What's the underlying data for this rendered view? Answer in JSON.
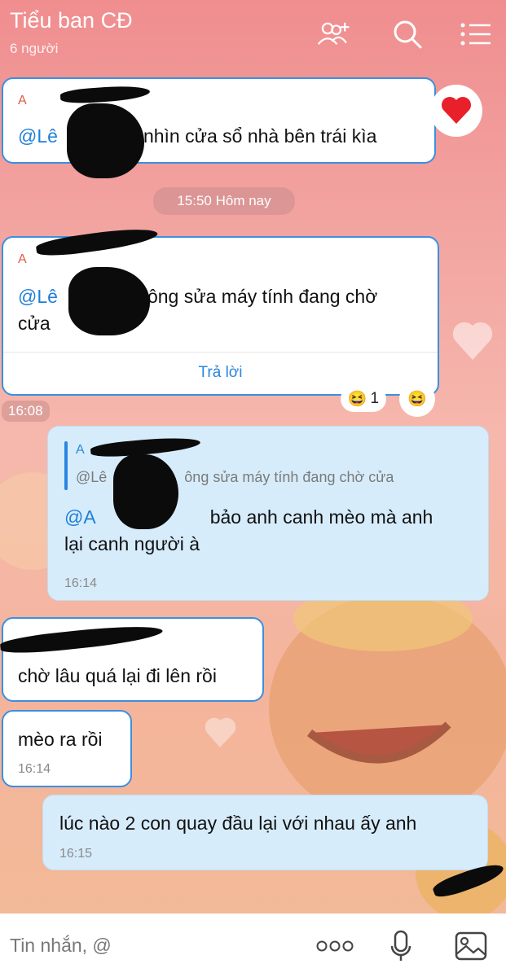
{
  "header": {
    "title": "Tiểu ban CĐ",
    "member_count": "6 người",
    "icons": [
      "add-member-icon",
      "search-icon",
      "menu-icon"
    ]
  },
  "messages": [
    {
      "id": "m1",
      "direction": "incoming",
      "quote_author": "A",
      "mention": "@Lê",
      "text": "nhìn cửa sổ nhà bên trái kìa",
      "reaction_icon": "heart"
    },
    {
      "id": "m2",
      "direction": "incoming",
      "quote_author": "A",
      "mention": "@Lê",
      "text_line1": "ông sửa máy tính đang chờ",
      "text_line2": "cửa",
      "reply_label": "Trả lời",
      "reaction_emoji": "😆",
      "reaction_count": "1",
      "time": "16:08"
    },
    {
      "id": "m3",
      "direction": "outgoing",
      "quote_author": "A",
      "quoted_mention": "@Lê",
      "quoted_text": "ông sửa máy tính đang chờ cửa",
      "mention": "@A",
      "text_line1": "bảo anh canh mèo mà anh",
      "text_line2": "lại canh người à",
      "time": "16:14"
    },
    {
      "id": "m4",
      "direction": "incoming",
      "text": "chờ lâu quá lại đi lên rồi"
    },
    {
      "id": "m5",
      "direction": "incoming",
      "text": "mèo ra rồi",
      "time": "16:14"
    },
    {
      "id": "m6",
      "direction": "outgoing",
      "text": "lúc nào 2 con quay đầu lại với nhau ấy anh",
      "time": "16:15"
    }
  ],
  "date_divider": "15:50 Hôm nay",
  "composer": {
    "placeholder": "Tin nhắn, @",
    "icons": [
      "more-icon",
      "microphone-icon",
      "image-icon"
    ]
  },
  "colors": {
    "accent": "#2a86df",
    "outgoing_bubble": "#d7ecfb",
    "author_name": "#e05b48"
  }
}
